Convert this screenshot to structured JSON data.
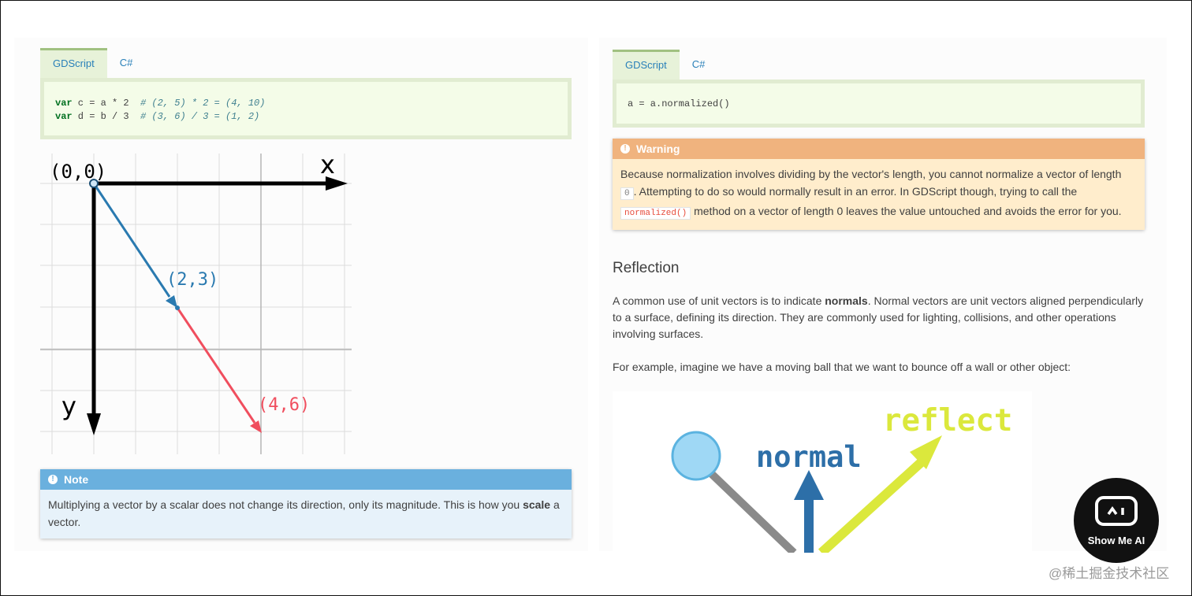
{
  "left": {
    "tabs": [
      {
        "label": "GDScript",
        "active": true
      },
      {
        "label": "C#",
        "active": false
      }
    ],
    "code": {
      "line1": {
        "kw": "var",
        "code": " c = a * 2  ",
        "comment": "# (2, 5) * 2 = (4, 10)"
      },
      "line2": {
        "kw": "var",
        "code": " d = b / 3  ",
        "comment": "# (3, 6) / 3 = (1, 2)"
      }
    },
    "diagram": {
      "origin_label": "(0,0)",
      "x_label": "x",
      "y_label": "y",
      "blue_label": "(2,3)",
      "red_label": "(4,6)",
      "colors": {
        "axis": "#000000",
        "blue": "#2a7ab0",
        "red": "#f04e5e",
        "grid": "#dcdcdc"
      }
    },
    "note": {
      "title": "Note",
      "text_before": "Multiplying a vector by a scalar does not change its direction, only its magnitude. This is how you ",
      "bold": "scale",
      "text_after": " a vector."
    }
  },
  "right": {
    "tabs": [
      {
        "label": "GDScript",
        "active": true
      },
      {
        "label": "C#",
        "active": false
      }
    ],
    "code_line": "a = a.normalized()",
    "warning": {
      "title": "Warning",
      "part1": "Because normalization involves dividing by the vector's length, you cannot normalize a vector of length ",
      "code1": "0",
      "part2": ". Attempting to do so would normally result in an error. In GDScript though, trying to call the ",
      "code2": "normalized()",
      "part3": " method on a vector of length 0 leaves the value untouched and avoids the error for you."
    },
    "heading": "Reflection",
    "para1_before": "A common use of unit vectors is to indicate ",
    "para1_bold": "normals",
    "para1_after": ". Normal vectors are unit vectors aligned perpendicularly to a surface, defining its direction. They are commonly used for lighting, collisions, and other operations involving surfaces.",
    "para2": "For example, imagine we have a moving ball that we want to bounce off a wall or other object:",
    "figure": {
      "normal_label": "normal",
      "reflect_label": "reflect",
      "colors": {
        "ball": "#9fd8f5",
        "normal": "#2d6fa8",
        "reflect": "#dbe83c",
        "incoming": "#8a8a8a"
      }
    }
  },
  "badge": {
    "label": "Show Me AI"
  },
  "watermark": "@稀土掘金技术社区"
}
